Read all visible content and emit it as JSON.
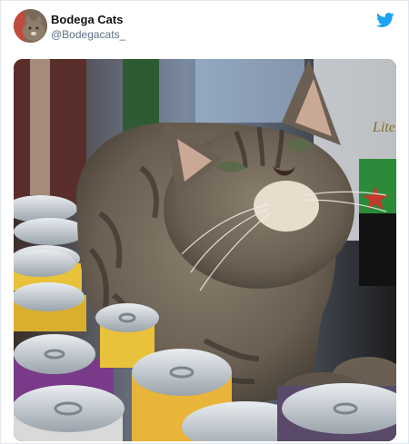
{
  "tweet": {
    "display_name": "Bodega Cats",
    "handle": "@Bodegacats_"
  },
  "icons": {
    "brand": "twitter-bird-icon",
    "avatar": "cat-avatar-icon"
  },
  "colors": {
    "twitter_blue": "#1da1f2",
    "handle_gray": "#5b7083"
  },
  "media": {
    "can_label": "Lite"
  }
}
